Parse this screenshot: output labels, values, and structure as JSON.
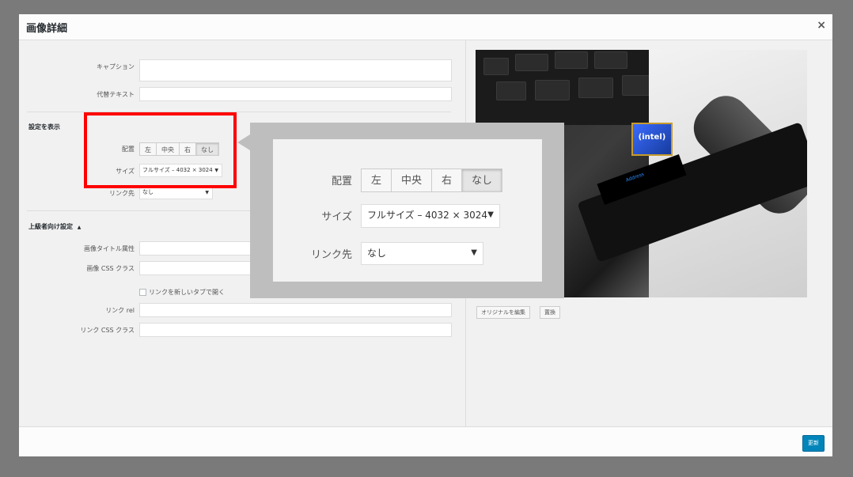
{
  "modal": {
    "title": "画像詳細",
    "close_icon": "×"
  },
  "form": {
    "caption_label": "キャプション",
    "alt_label": "代替テキスト",
    "display_section_title": "設定を表示",
    "align_label": "配置",
    "align_options": [
      "左",
      "中央",
      "右",
      "なし"
    ],
    "align_selected": "なし",
    "size_label": "サイズ",
    "size_value": "フルサイズ – 4032 × 3024",
    "link_label": "リンク先",
    "link_value": "なし",
    "advanced_section_title": "上級者向け設定",
    "advanced_toggle_icon": "▲",
    "title_attr_label": "画像タイトル属性",
    "css_class_label": "画像 CSS クラス",
    "new_tab_label": "リンクを新しいタブで開く",
    "link_rel_label": "リンク rel",
    "link_css_label": "リンク CSS クラス",
    "select_arrow": "▼"
  },
  "image": {
    "edit_original_label": "オリジナルを編集",
    "replace_label": "置換",
    "sticker_text": "(intel)",
    "screen_text": "Address"
  },
  "footer": {
    "update_label": "更新"
  },
  "callout": {
    "align_label": "配置",
    "align_options": [
      "左",
      "中央",
      "右",
      "なし"
    ],
    "size_label": "サイズ",
    "size_value": "フルサイズ – 4032 × 3024",
    "link_label": "リンク先",
    "link_value": "なし"
  },
  "colors": {
    "accent": "#0085ba",
    "highlight": "#ff0000",
    "overlay": "#7a7a7a"
  }
}
